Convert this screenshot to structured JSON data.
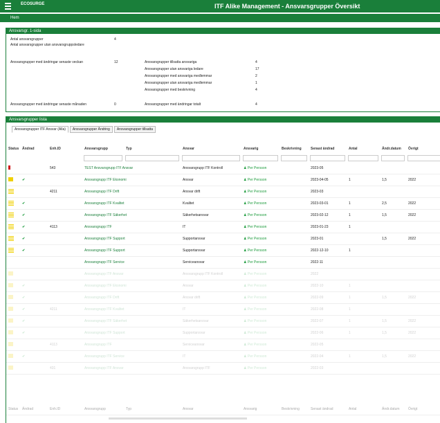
{
  "topbar": {
    "logo_line1": "ECOSURGE",
    "logo_line2": "",
    "title": "ITF Alike Management - Ansvarsgrupper Översikt"
  },
  "tabbar": {
    "label": "Hem"
  },
  "summary": {
    "header": "Ansvarsgr. 1-sida",
    "rows": [
      {
        "label": "Antal ansvarsgrupper",
        "value": "4"
      },
      {
        "label": "Antal ansvarsgrupper utan ansvarsgruppsledare",
        "value": ""
      }
    ],
    "left_block": [
      {
        "label": "Ansvarsgrupper med ändringar senaste veckan",
        "value": "12"
      },
      {
        "label": "Ansvarsgrupper med ändringar senaste månaden",
        "value": "0"
      }
    ],
    "right_block": [
      {
        "label": "Ansvarsgrupper tillsatta ansvariga",
        "value": "4"
      },
      {
        "label": "Ansvarsgrupper utan ansvariga ledare",
        "value": "17"
      },
      {
        "label": "Ansvarsgrupper med ansvariga medlemmar",
        "value": "2"
      },
      {
        "label": "Ansvarsgrupper utan ansvariga medlemmar",
        "value": "1"
      },
      {
        "label": "Ansvarsgrupper med beskrivning",
        "value": "4"
      },
      {
        "label": "Ansvarsgrupper med ändringar totalt",
        "value": "4"
      }
    ]
  },
  "list": {
    "header": "Ansvarsgrupper lista",
    "subtabs": [
      "Ansvarsgrupper ITF Ansvar (Alla)",
      "Ansvarsgrupper Ändring",
      "Ansvarsgrupper tillsatta"
    ],
    "columns": [
      "Status",
      "Ändrad",
      "Enh.ID",
      "Ansvarsgrupp",
      "Typ",
      "Ansvar",
      "Ansvarig",
      "Beskrivning",
      "Senast ändrad",
      "Antal",
      "Ändr.datum",
      "Övrigt"
    ],
    "rows": [
      {
        "flag": "red",
        "check": "",
        "id": "543",
        "name": "TEST Ansvarsgrupp ITF Ansvar",
        "type": "",
        "resp": "Ansvarsgrupp ITF Kontroll",
        "person": "Per Persson",
        "desc": "",
        "date": "2023-05",
        "count": "",
        "chg": "",
        "misc": ""
      },
      {
        "flag": "yellow",
        "check": "✔",
        "id": "",
        "name": "Ansvarsgrupp ITF Ekonomi",
        "type": "",
        "resp": "Ansvar",
        "person": "Per Persson",
        "desc": "",
        "date": "2023-04-05",
        "count": "1",
        "chg": "1,5",
        "misc": "2022"
      },
      {
        "flag": "bar",
        "check": "",
        "id": "4211",
        "name": "Ansvarsgrupp ITF Drift",
        "type": "",
        "resp": "Ansvar drift",
        "person": "Per Persson",
        "desc": "",
        "date": "2023-03",
        "count": "",
        "chg": "",
        "misc": ""
      },
      {
        "flag": "bar",
        "check": "✔",
        "id": "",
        "name": "Ansvarsgrupp ITF Kvalitet",
        "type": "",
        "resp": "Kvalitet",
        "person": "Per Persson",
        "desc": "",
        "date": "2023-03-01",
        "count": "1",
        "chg": "2,5",
        "misc": "2022"
      },
      {
        "flag": "bar",
        "check": "✔",
        "id": "",
        "name": "Ansvarsgrupp ITF Säkerhet",
        "type": "",
        "resp": "Säkerhetsansvar",
        "person": "Per Persson",
        "desc": "",
        "date": "2023-02-12",
        "count": "1",
        "chg": "1,5",
        "misc": "2022"
      },
      {
        "flag": "bar",
        "check": "✔",
        "id": "4113",
        "name": "Ansvarsgrupp ITF",
        "type": "",
        "resp": "IT",
        "person": "Per Persson",
        "desc": "",
        "date": "2023-01-23",
        "count": "1",
        "chg": "",
        "misc": ""
      },
      {
        "flag": "bar",
        "check": "✔",
        "id": "",
        "name": "Ansvarsgrupp ITF Support",
        "type": "",
        "resp": "Supportansvar",
        "person": "Per Persson",
        "desc": "",
        "date": "2023-01",
        "count": "",
        "chg": "1,5",
        "misc": "2022"
      },
      {
        "flag": "bar",
        "check": "✔",
        "id": "",
        "name": "Ansvarsgrupp ITF Support",
        "type": "",
        "resp": "Supportansvar",
        "person": "Per Persson",
        "desc": "",
        "date": "2022-12-10",
        "count": "1",
        "chg": "",
        "misc": ""
      },
      {
        "flag": "",
        "check": "",
        "id": "",
        "name": "Ansvarsgrupp ITF Service",
        "type": "",
        "resp": "Serviceansvar",
        "person": "Per Persson",
        "desc": "",
        "date": "2022-11",
        "count": "",
        "chg": "",
        "misc": ""
      }
    ],
    "faded_rows": [
      {
        "flag": "yellow",
        "check": "",
        "id": "",
        "name": "Ansvarsgrupp ITF Ansvar",
        "resp": "Ansvarsgrupp ITF Kontroll",
        "person": "Per Persson",
        "date": "2022",
        "count": "",
        "chg": "",
        "misc": ""
      },
      {
        "flag": "yellow",
        "check": "✔",
        "id": "",
        "name": "Ansvarsgrupp ITF Ekonomi",
        "resp": "Ansvar",
        "person": "Per Persson",
        "date": "2022-10",
        "count": "1",
        "chg": "",
        "misc": ""
      },
      {
        "flag": "yellow",
        "check": "✔",
        "id": "",
        "name": "Ansvarsgrupp ITF Drift",
        "resp": "Ansvar drift",
        "person": "Per Persson",
        "date": "2022-09",
        "count": "1",
        "chg": "1,5",
        "misc": "2022"
      },
      {
        "flag": "yellow",
        "check": "✔",
        "id": "4211",
        "name": "Ansvarsgrupp ITF Kvalitet",
        "resp": "IT",
        "person": "Per Persson",
        "date": "2022-08",
        "count": "1",
        "chg": "",
        "misc": ""
      },
      {
        "flag": "yellow",
        "check": "✔",
        "id": "",
        "name": "Ansvarsgrupp ITF Säkerhet",
        "resp": "Säkerhetsansvar",
        "person": "Per Persson",
        "date": "2022-07",
        "count": "1",
        "chg": "1,5",
        "misc": "2022"
      },
      {
        "flag": "yellow",
        "check": "✔",
        "id": "",
        "name": "Ansvarsgrupp ITF Support",
        "resp": "Supportansvar",
        "person": "Per Persson",
        "date": "2022-06",
        "count": "1",
        "chg": "1,5",
        "misc": "2022"
      },
      {
        "flag": "yellow",
        "check": "",
        "id": "4113",
        "name": "Ansvarsgrupp ITF",
        "resp": "Serviceansvar",
        "person": "Per Persson",
        "date": "2022-05",
        "count": "",
        "chg": "",
        "misc": ""
      },
      {
        "flag": "yellow",
        "check": "✔",
        "id": "",
        "name": "Ansvarsgrupp ITF Service",
        "resp": "IT",
        "person": "Per Persson",
        "date": "2022-04",
        "count": "1",
        "chg": "1,5",
        "misc": "2022"
      },
      {
        "flag": "yellow",
        "check": "",
        "id": "431",
        "name": "Ansvarsgrupp ITF Ansvar",
        "resp": "Ansvarsgrupp ITF",
        "person": "Per Persson",
        "date": "2022-03",
        "count": "",
        "chg": "",
        "misc": ""
      }
    ],
    "footer": [
      "Status",
      "Ändrad",
      "Enh.ID",
      "Ansvarsgrupp",
      "Typ",
      "Ansvar",
      "Ansvarig",
      "Beskrivning",
      "Senast ändrad",
      "Antal",
      "Ändr.datum",
      "Övrigt"
    ]
  }
}
